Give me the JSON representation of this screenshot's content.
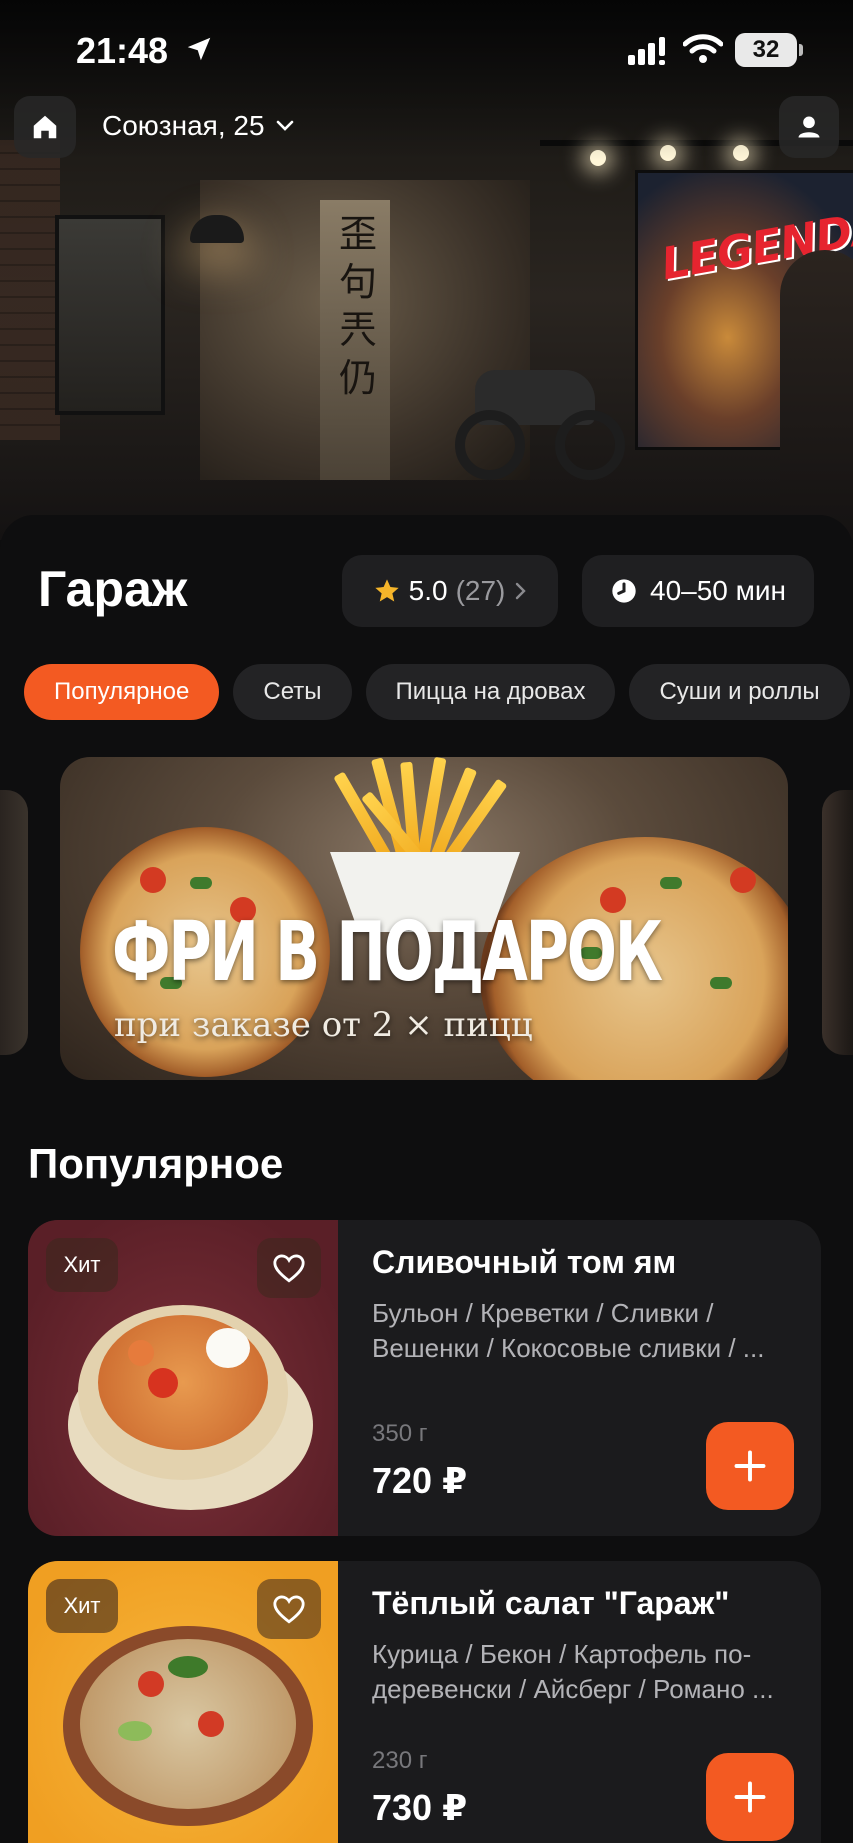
{
  "status_bar": {
    "time": "21:48",
    "battery": "32"
  },
  "header": {
    "address": "Союзная, 25"
  },
  "hero": {
    "mural_text": "LEGENDARY",
    "calligraphy": "歪 句 兲 仍"
  },
  "restaurant": {
    "name": "Гараж",
    "rating": "5.0",
    "reviews": "(27)",
    "delivery_time": "40–50 мин"
  },
  "tabs": [
    {
      "label": "Популярное",
      "active": true
    },
    {
      "label": "Сеты"
    },
    {
      "label": "Пицца на дровах"
    },
    {
      "label": "Суши и роллы"
    }
  ],
  "banner": {
    "title": "ФРИ В ПОДАРОК",
    "subtitle": "при заказе от 2 × пицц"
  },
  "section": {
    "title": "Популярное"
  },
  "products": [
    {
      "badge": "Хит",
      "name": "Сливочный том ям",
      "desc_line1": "Бульон / Креветки / Сливки /",
      "desc_line2": "Вешенки / Кокосовые сливки / ...",
      "weight": "350 г",
      "price": "720 ₽",
      "bg": "#6b2a33"
    },
    {
      "badge": "Хит",
      "name": "Тёплый салат \"Гараж\"",
      "desc_line1": "Курица / Бекон / Картофель по-",
      "desc_line2": "деревенски / Айсберг / Романо ...",
      "weight": "230 г",
      "price": "730 ₽",
      "bg": "#f2a52c"
    }
  ],
  "colors": {
    "accent": "#f35a22",
    "background": "#0e0e0f",
    "card": "#1b1b1d"
  }
}
